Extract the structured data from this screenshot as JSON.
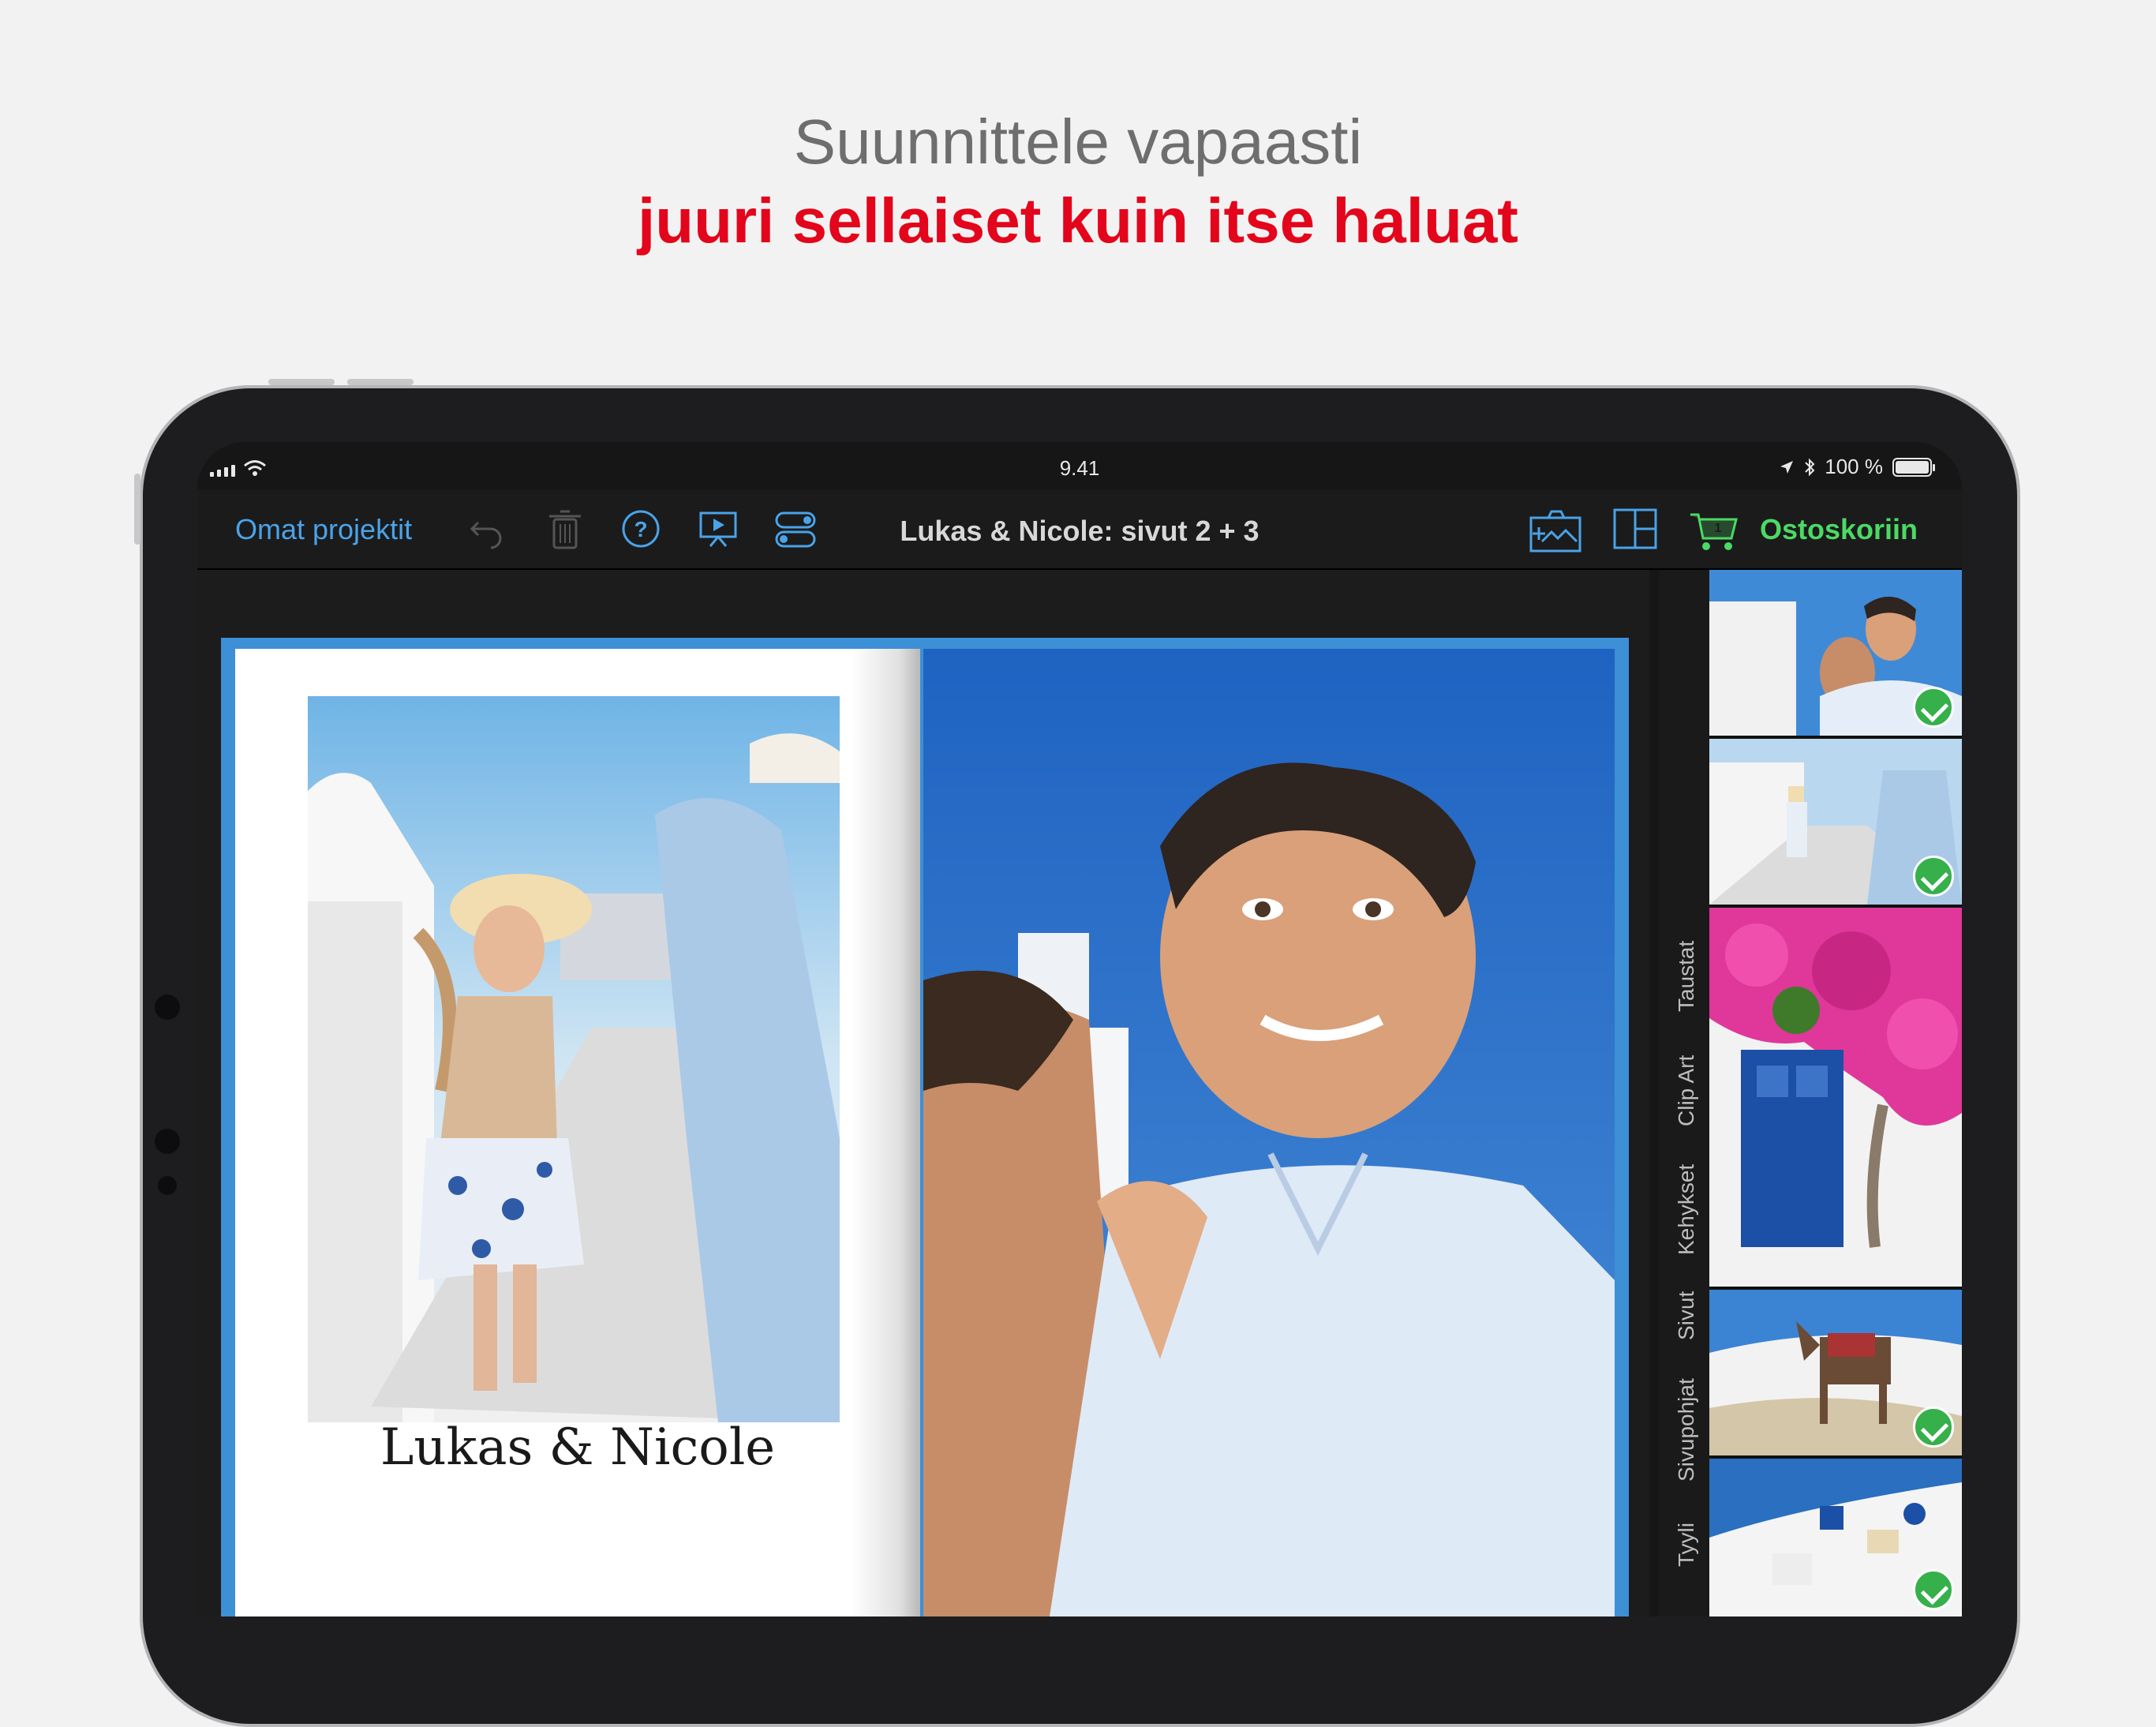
{
  "headline": {
    "line1": "Suunnittele vapaasti",
    "line2": "juuri sellaiset kuin itse haluat"
  },
  "statusbar": {
    "time": "9.41",
    "battery": "100 %"
  },
  "toolbar": {
    "projects_link": "Omat projektit",
    "title": "Lukas & Nicole: sivut 2 + 3",
    "cart_label": "Ostoskoriin",
    "cart_count": "1",
    "icons": [
      "undo-icon",
      "trash-icon",
      "help-icon",
      "slideshow-icon",
      "settings-toggle-icon",
      "add-photo-icon",
      "layout-icon",
      "cart-icon"
    ]
  },
  "album": {
    "caption": "Lukas & Nicole"
  },
  "sidebar": {
    "tabs": [
      "Taustat",
      "Clip Art",
      "Kehykset",
      "Sivut",
      "Sivupohjat",
      "Tyyli"
    ]
  },
  "thumbnails": [
    {
      "subject": "couple-kiss",
      "checked": true
    },
    {
      "subject": "couple-walking",
      "checked": true
    },
    {
      "subject": "flowers-blue-door",
      "checked": false
    },
    {
      "subject": "donkey-santorini",
      "checked": true
    },
    {
      "subject": "santorini-village",
      "checked": true
    }
  ],
  "colors": {
    "accent": "#4aa3e8",
    "cart": "#4cd964",
    "headline_red": "#e3051b",
    "check": "#35b04a"
  }
}
